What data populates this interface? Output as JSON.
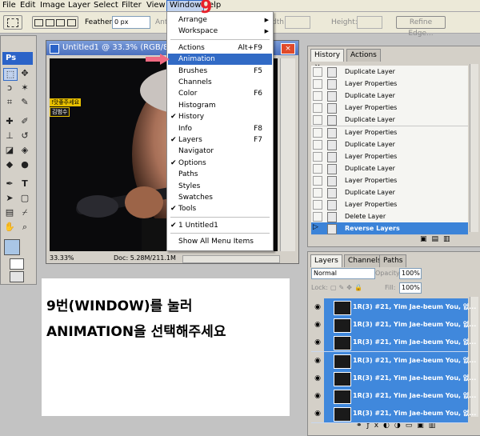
{
  "menubar": {
    "items": [
      "File",
      "Edit",
      "Image",
      "Layer",
      "Select",
      "Filter",
      "View",
      "Window",
      "Help"
    ],
    "active_label": "Window",
    "help_fragment": "elp"
  },
  "options_bar": {
    "feather_label": "Feather:",
    "feather_value": "0 px",
    "antialias_label": "Anti-a",
    "width_label": "dth:",
    "height_label": "Height:",
    "refine_edge_label": "Refine Edge..."
  },
  "toolbox": {
    "ps_badge": "Ps"
  },
  "document": {
    "title": "Untitled1 @ 33.3% (RGB/8#)",
    "zoom": "33.33%",
    "doc_size": "Doc: 5.28M/211.1M",
    "overlay_text_1": "!맛좋주세요",
    "overlay_text_2": "김범수"
  },
  "window_menu": {
    "items": [
      {
        "label": "Arrange",
        "submenu": true
      },
      {
        "label": "Workspace",
        "submenu": true
      },
      {
        "label": "Actions",
        "shortcut": "Alt+F9"
      },
      {
        "label": "Animation",
        "highlighted": true
      },
      {
        "label": "Brushes",
        "shortcut": "F5"
      },
      {
        "label": "Channels"
      },
      {
        "label": "Color",
        "shortcut": "F6"
      },
      {
        "label": "Histogram"
      },
      {
        "label": "History",
        "checked": true
      },
      {
        "label": "Info",
        "shortcut": "F8"
      },
      {
        "label": "Layers",
        "shortcut": "F7",
        "checked": true
      },
      {
        "label": "Navigator"
      },
      {
        "label": "Options",
        "checked": true
      },
      {
        "label": "Paths"
      },
      {
        "label": "Styles"
      },
      {
        "label": "Swatches"
      },
      {
        "label": "Tools",
        "checked": true
      },
      {
        "label": "1 Untitled1",
        "checked": true
      },
      {
        "label": "Show All Menu Items"
      }
    ]
  },
  "history_panel": {
    "tabs": [
      "History",
      "Actions"
    ],
    "rows": [
      "Duplicate Layer",
      "Layer Properties",
      "Duplicate Layer",
      "Layer Properties",
      "Duplicate Layer",
      "Layer Properties",
      "Duplicate Layer",
      "Layer Properties",
      "Duplicate Layer",
      "Layer Properties",
      "Duplicate Layer",
      "Layer Properties",
      "Delete Layer",
      "Reverse Layers"
    ],
    "selected": "Reverse Layers"
  },
  "layers_panel": {
    "tabs": [
      "Layers",
      "Channels",
      "Paths"
    ],
    "blend_mode": "Normal",
    "opacity_label": "Opacity:",
    "opacity_value": "100%",
    "lock_label": "Lock:",
    "fill_label": "Fill:",
    "fill_value": "100%",
    "layer_name": "1R(3) #21, Yim Jae-beum  You, 없...",
    "layer_count": 7
  },
  "annotation": {
    "step_number": "9",
    "line1": "9번(WINDOW)를 눌러",
    "line2": "ANIMATION을 선택해주세요"
  },
  "colors": {
    "highlight": "#316ac5",
    "selected_row": "#3b83d8",
    "layer_row": "#4088dc",
    "step_red": "#e8202a",
    "arrow_pink": "#f06a82"
  }
}
